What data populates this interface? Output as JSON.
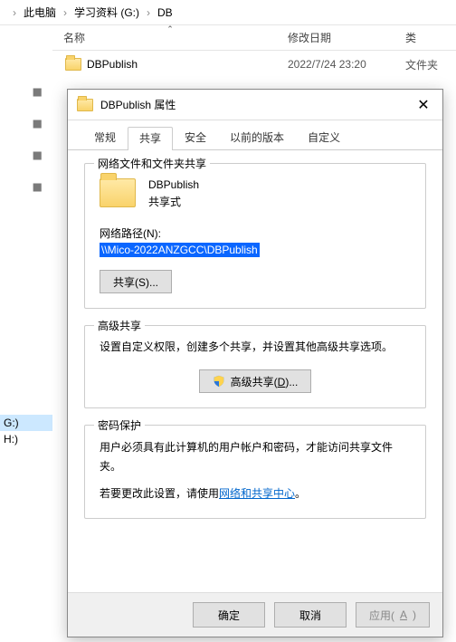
{
  "explorer": {
    "breadcrumbs": [
      "此电脑",
      "学习资料 (G:)",
      "DB"
    ],
    "columns": {
      "name": "名称",
      "modified": "修改日期",
      "type": "类"
    },
    "rows": [
      {
        "name": "DBPublish",
        "modified": "2022/7/24 23:20",
        "type": "文件夹"
      }
    ],
    "nav": {
      "driveG": "G:)",
      "driveH": "H:)"
    }
  },
  "dialog": {
    "title": "DBPublish 属性",
    "close": "✕",
    "tabs": {
      "general": "常规",
      "sharing": "共享",
      "security": "安全",
      "previous": "以前的版本",
      "custom": "自定义"
    },
    "sharing": {
      "group_label": "网络文件和文件夹共享",
      "folder_name": "DBPublish",
      "share_mode": "共享式",
      "path_label": "网络路径(N):",
      "network_path": "\\\\Mico-2022ANZGCC\\DBPublish",
      "share_button": "共享(S)..."
    },
    "advanced": {
      "group_label": "高级共享",
      "description": "设置自定义权限，创建多个共享，并设置其他高级共享选项。",
      "button_prefix": "高级共享(",
      "button_key": "D",
      "button_suffix": ")..."
    },
    "password": {
      "group_label": "密码保护",
      "line1": "用户必须具有此计算机的用户帐户和密码，才能访问共享文件夹。",
      "line2_prefix": "若要更改此设置，请使用",
      "link": "网络和共享中心",
      "line2_suffix": "。"
    },
    "buttons": {
      "ok": "确定",
      "cancel": "取消",
      "apply_prefix": "应用(",
      "apply_key": "A",
      "apply_suffix": ")"
    }
  }
}
